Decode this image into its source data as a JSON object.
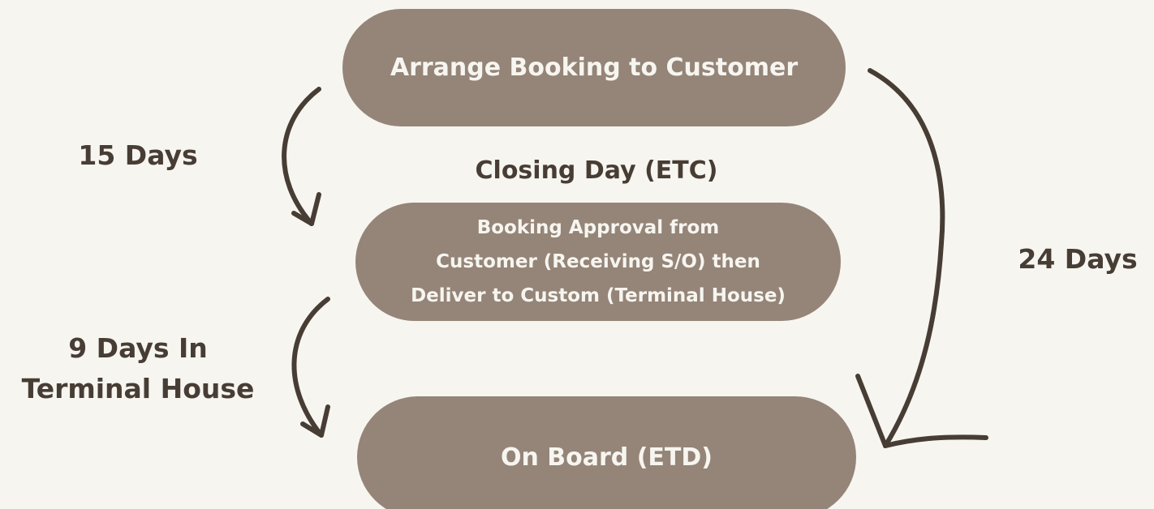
{
  "nodes": {
    "arrange_booking": "Arrange Booking to Customer",
    "booking_approval": {
      "line1": "Booking Approval from",
      "line2": "Customer (Receiving S/O) then",
      "line3": "Deliver to Custom (Terminal House)"
    },
    "on_board": "On Board (ETD)"
  },
  "labels": {
    "closing_day": "Closing Day (ETC)",
    "days_15": "15 Days",
    "days_24": "24 Days",
    "days_9_line1": "9 Days In",
    "days_9_line2": "Terminal House"
  },
  "colors": {
    "background": "#f7f5f0",
    "pill_fill": "#948578",
    "pill_text": "#f7f5f0",
    "label_text": "#473d35",
    "arrow": "#473d35"
  }
}
